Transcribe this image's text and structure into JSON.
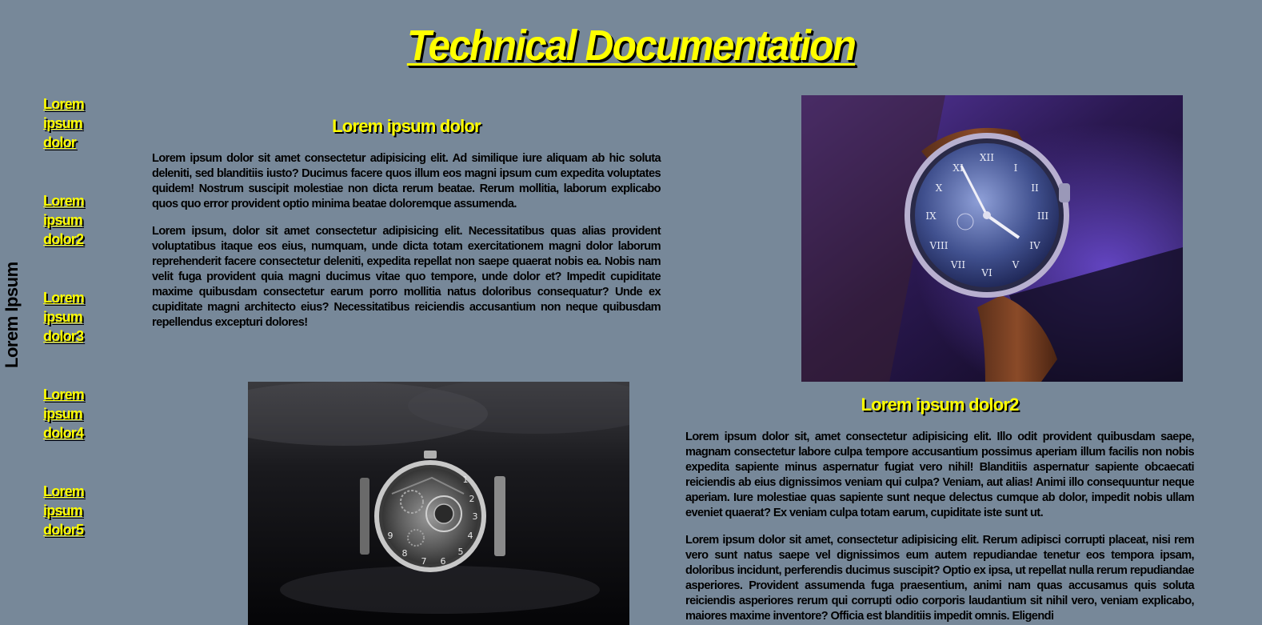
{
  "header": {
    "title": "Technical Documentation"
  },
  "sidebar": {
    "vertical_label": "Lorem Ipsum",
    "links": [
      {
        "label": "Lorem ipsum dolor"
      },
      {
        "label": "Lorem ipsum dolor2"
      },
      {
        "label": "Lorem ipsum dolor3"
      },
      {
        "label": "Lorem ipsum dolor4"
      },
      {
        "label": "Lorem ipsum dolor5"
      }
    ]
  },
  "sections": [
    {
      "title": "Lorem ipsum dolor",
      "paragraphs": [
        "Lorem ipsum dolor sit amet consectetur adipisicing elit. Ad similique iure aliquam ab hic soluta deleniti, sed blanditiis iusto? Ducimus facere quos illum eos magni ipsum cum expedita voluptates quidem! Nostrum suscipit molestiae non dicta rerum beatae. Rerum mollitia, laborum explicabo quos quo error provident optio minima beatae doloremque assumenda.",
        "Lorem ipsum, dolor sit amet consectetur adipisicing elit. Necessitatibus quas alias provident voluptatibus itaque eos eius, numquam, unde dicta totam exercitationem magni dolor laborum reprehenderit facere consectetur deleniti, expedita repellat non saepe quaerat nobis ea. Nobis nam velit fuga provident quia magni ducimus vitae quo tempore, unde dolor et? Impedit cupiditate maxime quibusdam consectetur earum porro mollitia natus doloribus consequatur? Unde ex cupiditate magni architecto eius? Necessitatibus reiciendis accusantium non neque quibusdam repellendus excepturi dolores!"
      ]
    },
    {
      "title": "Lorem ipsum dolor2",
      "paragraphs": [
        "Lorem ipsum dolor sit, amet consectetur adipisicing elit. Illo odit provident quibusdam saepe, magnam consectetur labore culpa tempore accusantium possimus aperiam illum facilis non nobis expedita sapiente minus aspernatur fugiat vero nihil! Blanditiis aspernatur sapiente obcaecati reiciendis ab eius dignissimos veniam qui culpa? Veniam, aut alias! Animi illo consequuntur neque aperiam. Iure molestiae quas sapiente sunt neque delectus cumque ab dolor, impedit nobis ullam eveniet quaerat? Ex veniam culpa totam earum, cupiditate iste sunt ut.",
        "Lorem ipsum dolor sit amet, consectetur adipisicing elit. Rerum adipisci corrupti placeat, nisi rem vero sunt natus saepe vel dignissimos eum autem repudiandae tenetur eos tempora ipsam, doloribus incidunt, perferendis ducimus suscipit? Optio ex ipsa, ut repellat nulla rerum repudiandae asperiores. Provident assumenda fuga praesentium, animi nam quas accusamus quis soluta reiciendis asperiores rerum qui corrupti odio corporis laudantium sit nihil vero, veniam explicabo, maiores maxime inventore? Officia est blanditiis impedit omnis. Eligendi"
      ]
    }
  ],
  "colors": {
    "background": "#778899",
    "accent": "#ffff00",
    "text": "#000000"
  }
}
